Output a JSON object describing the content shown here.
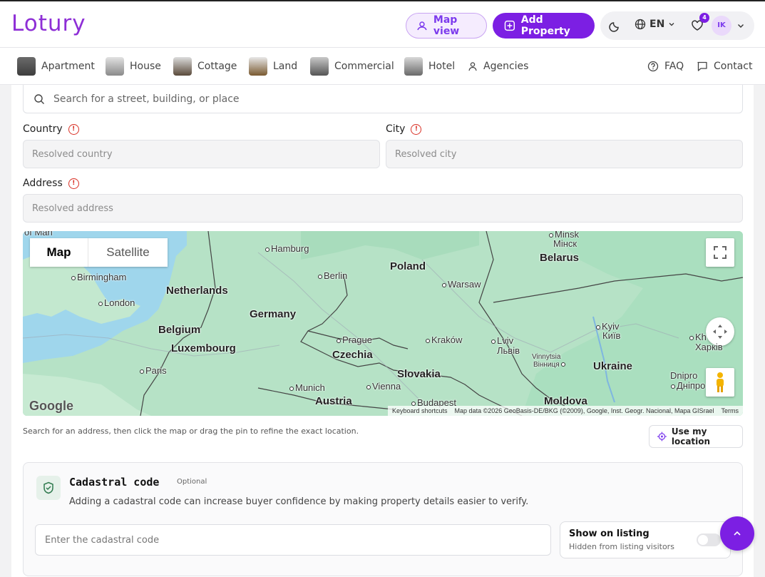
{
  "brand": {
    "name": "Lotury",
    "accent": "#7c1fe3"
  },
  "header": {
    "map_view_label": "Map view",
    "add_property_label": "Add Property",
    "language": "EN",
    "favorites_count": "4",
    "user_initials": "IK"
  },
  "nav": {
    "categories": [
      {
        "label": "Apartment",
        "icon": "apartment-icon"
      },
      {
        "label": "House",
        "icon": "house-icon"
      },
      {
        "label": "Cottage",
        "icon": "cottage-icon"
      },
      {
        "label": "Land",
        "icon": "land-icon"
      },
      {
        "label": "Commercial",
        "icon": "commercial-icon"
      },
      {
        "label": "Hotel",
        "icon": "hotel-icon"
      },
      {
        "label": "Agencies",
        "icon": "user-icon"
      }
    ],
    "faq_label": "FAQ",
    "contact_label": "Contact"
  },
  "form": {
    "search_placeholder": "Search for a street, building, or place",
    "country_label": "Country",
    "country_placeholder": "Resolved country",
    "city_label": "City",
    "city_placeholder": "Resolved city",
    "address_label": "Address",
    "address_placeholder": "Resolved address",
    "hint": "Search for an address, then click the map or drag the pin to refine the exact location.",
    "use_location_label": "Use my location"
  },
  "map": {
    "tab_map": "Map",
    "tab_satellite": "Satellite",
    "google": "Google",
    "attribution": [
      "Keyboard shortcuts",
      "Map data ©2026 GeoBasis-DE/BKG (©2009), Google, Inst. Geogr. Nacional, Mapa GISrael",
      "Terms"
    ],
    "labels": {
      "isle_of_man": "of Man",
      "hamburg": "Hamburg",
      "minsk": "Minsk",
      "minsk_cyr": "Мінск",
      "belarus": "Belarus",
      "birmingham": "Birmingham",
      "berlin": "Berlin",
      "poland": "Poland",
      "warsaw": "Warsaw",
      "netherlands": "Netherlands",
      "london": "London",
      "germany": "Germany",
      "belgium": "Belgium",
      "prague": "Prague",
      "krakow": "Kraków",
      "lviv": "Lviv",
      "lviv_cyr": "Львів",
      "kyiv": "Kyiv",
      "kyiv_cyr": "Київ",
      "kharkiv": "Kh",
      "kharkiv_cyr": "Харків",
      "luxembourg": "Luxembourg",
      "czechia": "Czechia",
      "vinnytsia": "Vinnytsia",
      "vinnytsia_cyr": "Вінниця",
      "paris": "Paris",
      "slovakia": "Slovakia",
      "ukraine": "Ukraine",
      "dnipro": "Dnipro",
      "dnipro_cyr": "Дніпро",
      "munich": "Munich",
      "vienna": "Vienna",
      "austria": "Austria",
      "budapest": "Budapest",
      "moldova": "Moldova"
    }
  },
  "cadastral": {
    "title": "Cadastral code",
    "optional": "Optional",
    "description": "Adding a cadastral code can increase buyer confidence by making property details easier to verify.",
    "placeholder": "Enter the cadastral code",
    "show_title": "Show on listing",
    "show_subtitle": "Hidden from listing visitors",
    "show_enabled": false
  }
}
